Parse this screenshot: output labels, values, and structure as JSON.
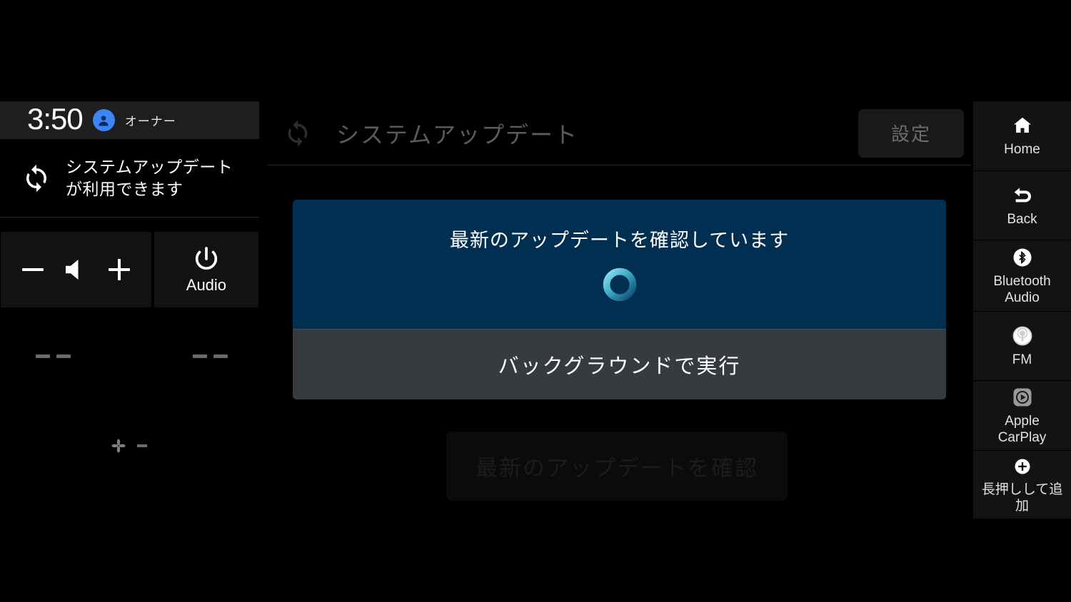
{
  "status_bar": {
    "clock": "3:50",
    "profile_name": "オーナー",
    "avatar_icon": "person-icon"
  },
  "notification": {
    "icon": "sync-icon",
    "text": "システムアップデートが利用できます"
  },
  "volume_control": {
    "decrease_label": "−",
    "increase_label": "+",
    "speaker_icon": "speaker-icon"
  },
  "audio_button": {
    "label": "Audio",
    "icon": "power-icon"
  },
  "climate": {
    "left_temp": "--",
    "right_temp": "--",
    "fan_icon": "fan-icon",
    "fan_level": "-"
  },
  "main": {
    "header": {
      "icon": "sync-icon",
      "title": "システムアップデート",
      "settings_label": "設定"
    },
    "dialog": {
      "message": "最新のアップデートを確認しています",
      "spinner_icon": "loading-spinner-icon",
      "action_label": "バックグラウンドで実行"
    },
    "check_button": {
      "label": "最新のアップデートを確認",
      "enabled": false
    }
  },
  "rail": {
    "items": [
      {
        "label": "Home",
        "icon": "home-icon"
      },
      {
        "label": "Back",
        "icon": "back-arrow-icon"
      },
      {
        "label": "Bluetooth\nAudio",
        "icon": "bluetooth-icon"
      },
      {
        "label": "FM",
        "icon": "radio-antenna-icon"
      },
      {
        "label": "Apple\nCarPlay",
        "icon": "carplay-icon"
      },
      {
        "label": "長押しして追加",
        "icon": "plus-circle-icon"
      }
    ]
  },
  "colors": {
    "dialog_blue": "#012f52",
    "dialog_action_gray": "#373b40",
    "avatar_blue": "#3b85f5",
    "spinner_cyan": "#63cfe0",
    "background": "#000000"
  }
}
